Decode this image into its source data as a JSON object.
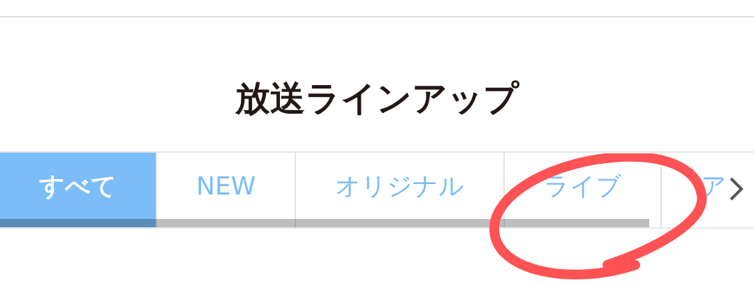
{
  "title": "放送ラインアップ",
  "tabs": [
    {
      "label": "すべて",
      "selected": true
    },
    {
      "label": "NEW",
      "selected": false
    },
    {
      "label": "オリジナル",
      "selected": false
    },
    {
      "label": "ライブ",
      "selected": false
    },
    {
      "label": "ア",
      "selected": false
    }
  ]
}
